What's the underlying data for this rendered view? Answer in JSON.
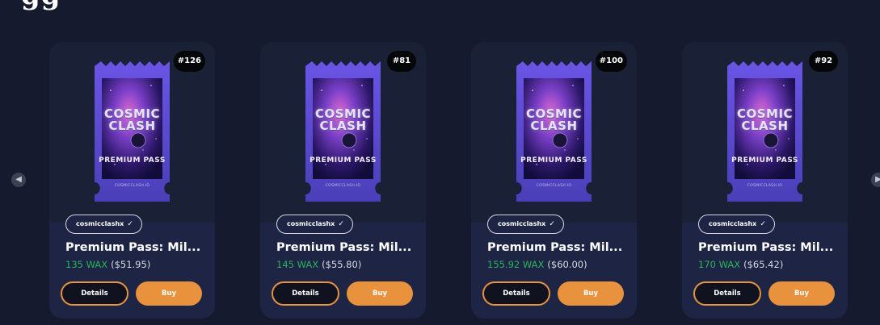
{
  "colors": {
    "background": "#151a2e",
    "card": "#1d2444",
    "accent_orange": "#e8923e",
    "wax_green": "#2cb35e",
    "ticket_purple": "#5b4bd6"
  },
  "nav": {
    "prev_icon": "chevron-left-icon",
    "next_icon": "chevron-right-icon"
  },
  "cards": [
    {
      "badge": "#126",
      "ticket": {
        "title": "COSMIC CLASH",
        "subtitle": "PREMIUM PASS",
        "footer": "COSMICCLASH.IO"
      },
      "collection": "cosmicclashx",
      "name": "Premium Pass: Mil...",
      "price_wax": "135 WAX",
      "price_usd": "($51.95)",
      "details_label": "Details",
      "buy_label": "Buy"
    },
    {
      "badge": "#81",
      "ticket": {
        "title": "COSMIC CLASH",
        "subtitle": "PREMIUM PASS",
        "footer": "COSMICCLASH.IO"
      },
      "collection": "cosmicclashx",
      "name": "Premium Pass: Mil...",
      "price_wax": "145 WAX",
      "price_usd": "($55.80)",
      "details_label": "Details",
      "buy_label": "Buy"
    },
    {
      "badge": "#100",
      "ticket": {
        "title": "COSMIC CLASH",
        "subtitle": "PREMIUM PASS",
        "footer": "COSMICCLASH.IO"
      },
      "collection": "cosmicclashx",
      "name": "Premium Pass: Mil...",
      "price_wax": "155.92 WAX",
      "price_usd": "($60.00)",
      "details_label": "Details",
      "buy_label": "Buy"
    },
    {
      "badge": "#92",
      "ticket": {
        "title": "COSMIC CLASH",
        "subtitle": "PREMIUM PASS",
        "footer": "COSMICCLASH.IO"
      },
      "collection": "cosmicclashx",
      "name": "Premium Pass: Mil...",
      "price_wax": "170 WAX",
      "price_usd": "($65.42)",
      "details_label": "Details",
      "buy_label": "Buy"
    }
  ]
}
